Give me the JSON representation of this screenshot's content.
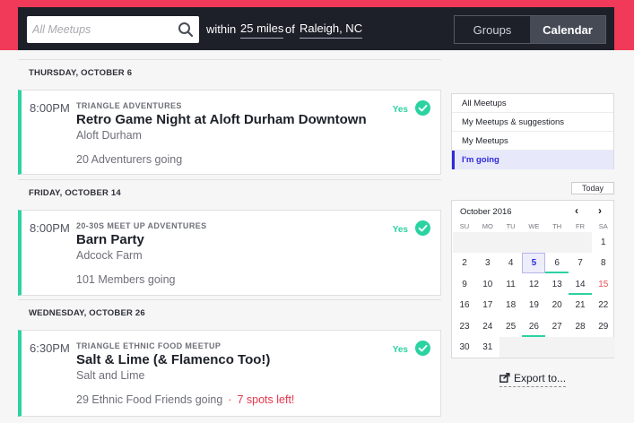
{
  "search": {
    "placeholder": "All Meetups",
    "within_label": "within",
    "radius": "25 miles",
    "of_label": "of",
    "location": "Raleigh, NC"
  },
  "view_toggle": {
    "groups": "Groups",
    "calendar": "Calendar",
    "selected": "Calendar"
  },
  "days": [
    {
      "header": "THURSDAY, OCTOBER 6",
      "event": {
        "time": "8:00PM",
        "group": "TRIANGLE ADVENTURES",
        "title": "Retro Game Night at Aloft Durham Downtown",
        "venue": "Aloft Durham",
        "going": "20 Adventurers going",
        "spots": "",
        "rsvp": "Yes"
      }
    },
    {
      "header": "FRIDAY, OCTOBER 14",
      "event": {
        "time": "8:00PM",
        "group": "20-30S MEET UP ADVENTURES",
        "title": "Barn Party",
        "venue": "Adcock Farm",
        "going": "101 Members going",
        "spots": "",
        "rsvp": "Yes"
      }
    },
    {
      "header": "WEDNESDAY, OCTOBER 26",
      "event": {
        "time": "6:30PM",
        "group": "TRIANGLE ETHNIC FOOD MEETUP",
        "title": "Salt & Lime (& Flamenco Too!)",
        "venue": "Salt and Lime",
        "going": "29 Ethnic Food Friends going",
        "separator": "·",
        "spots": "7 spots left!",
        "rsvp": "Yes"
      }
    }
  ],
  "filters": [
    "All Meetups",
    "My Meetups & suggestions",
    "My Meetups",
    "I'm going"
  ],
  "active_filter": "I'm going",
  "today_button": "Today",
  "calendar": {
    "month": "October 2016",
    "prev_icon": "chevron-left-icon",
    "next_icon": "chevron-right-icon",
    "weekdays": [
      "SU",
      "MO",
      "TU",
      "WE",
      "TH",
      "FR",
      "SA"
    ],
    "weeks": [
      [
        "",
        "",
        "",
        "",
        "",
        "",
        "1"
      ],
      [
        "2",
        "3",
        "4",
        "5",
        "6",
        "7",
        "8"
      ],
      [
        "9",
        "10",
        "11",
        "12",
        "13",
        "14",
        "15"
      ],
      [
        "16",
        "17",
        "18",
        "19",
        "20",
        "21",
        "22"
      ],
      [
        "23",
        "24",
        "25",
        "26",
        "27",
        "28",
        "29"
      ],
      [
        "30",
        "31",
        "",
        "",
        "",
        "",
        ""
      ]
    ],
    "today": "5",
    "event_days": [
      "6",
      "14",
      "26"
    ],
    "highlight_days": [
      "15"
    ]
  },
  "export_label": "Export to...",
  "colors": {
    "brand": "#f13a59",
    "accent": "#2bd2a2",
    "active_filter": "#2d2ad9",
    "spots": "#e8354b"
  }
}
